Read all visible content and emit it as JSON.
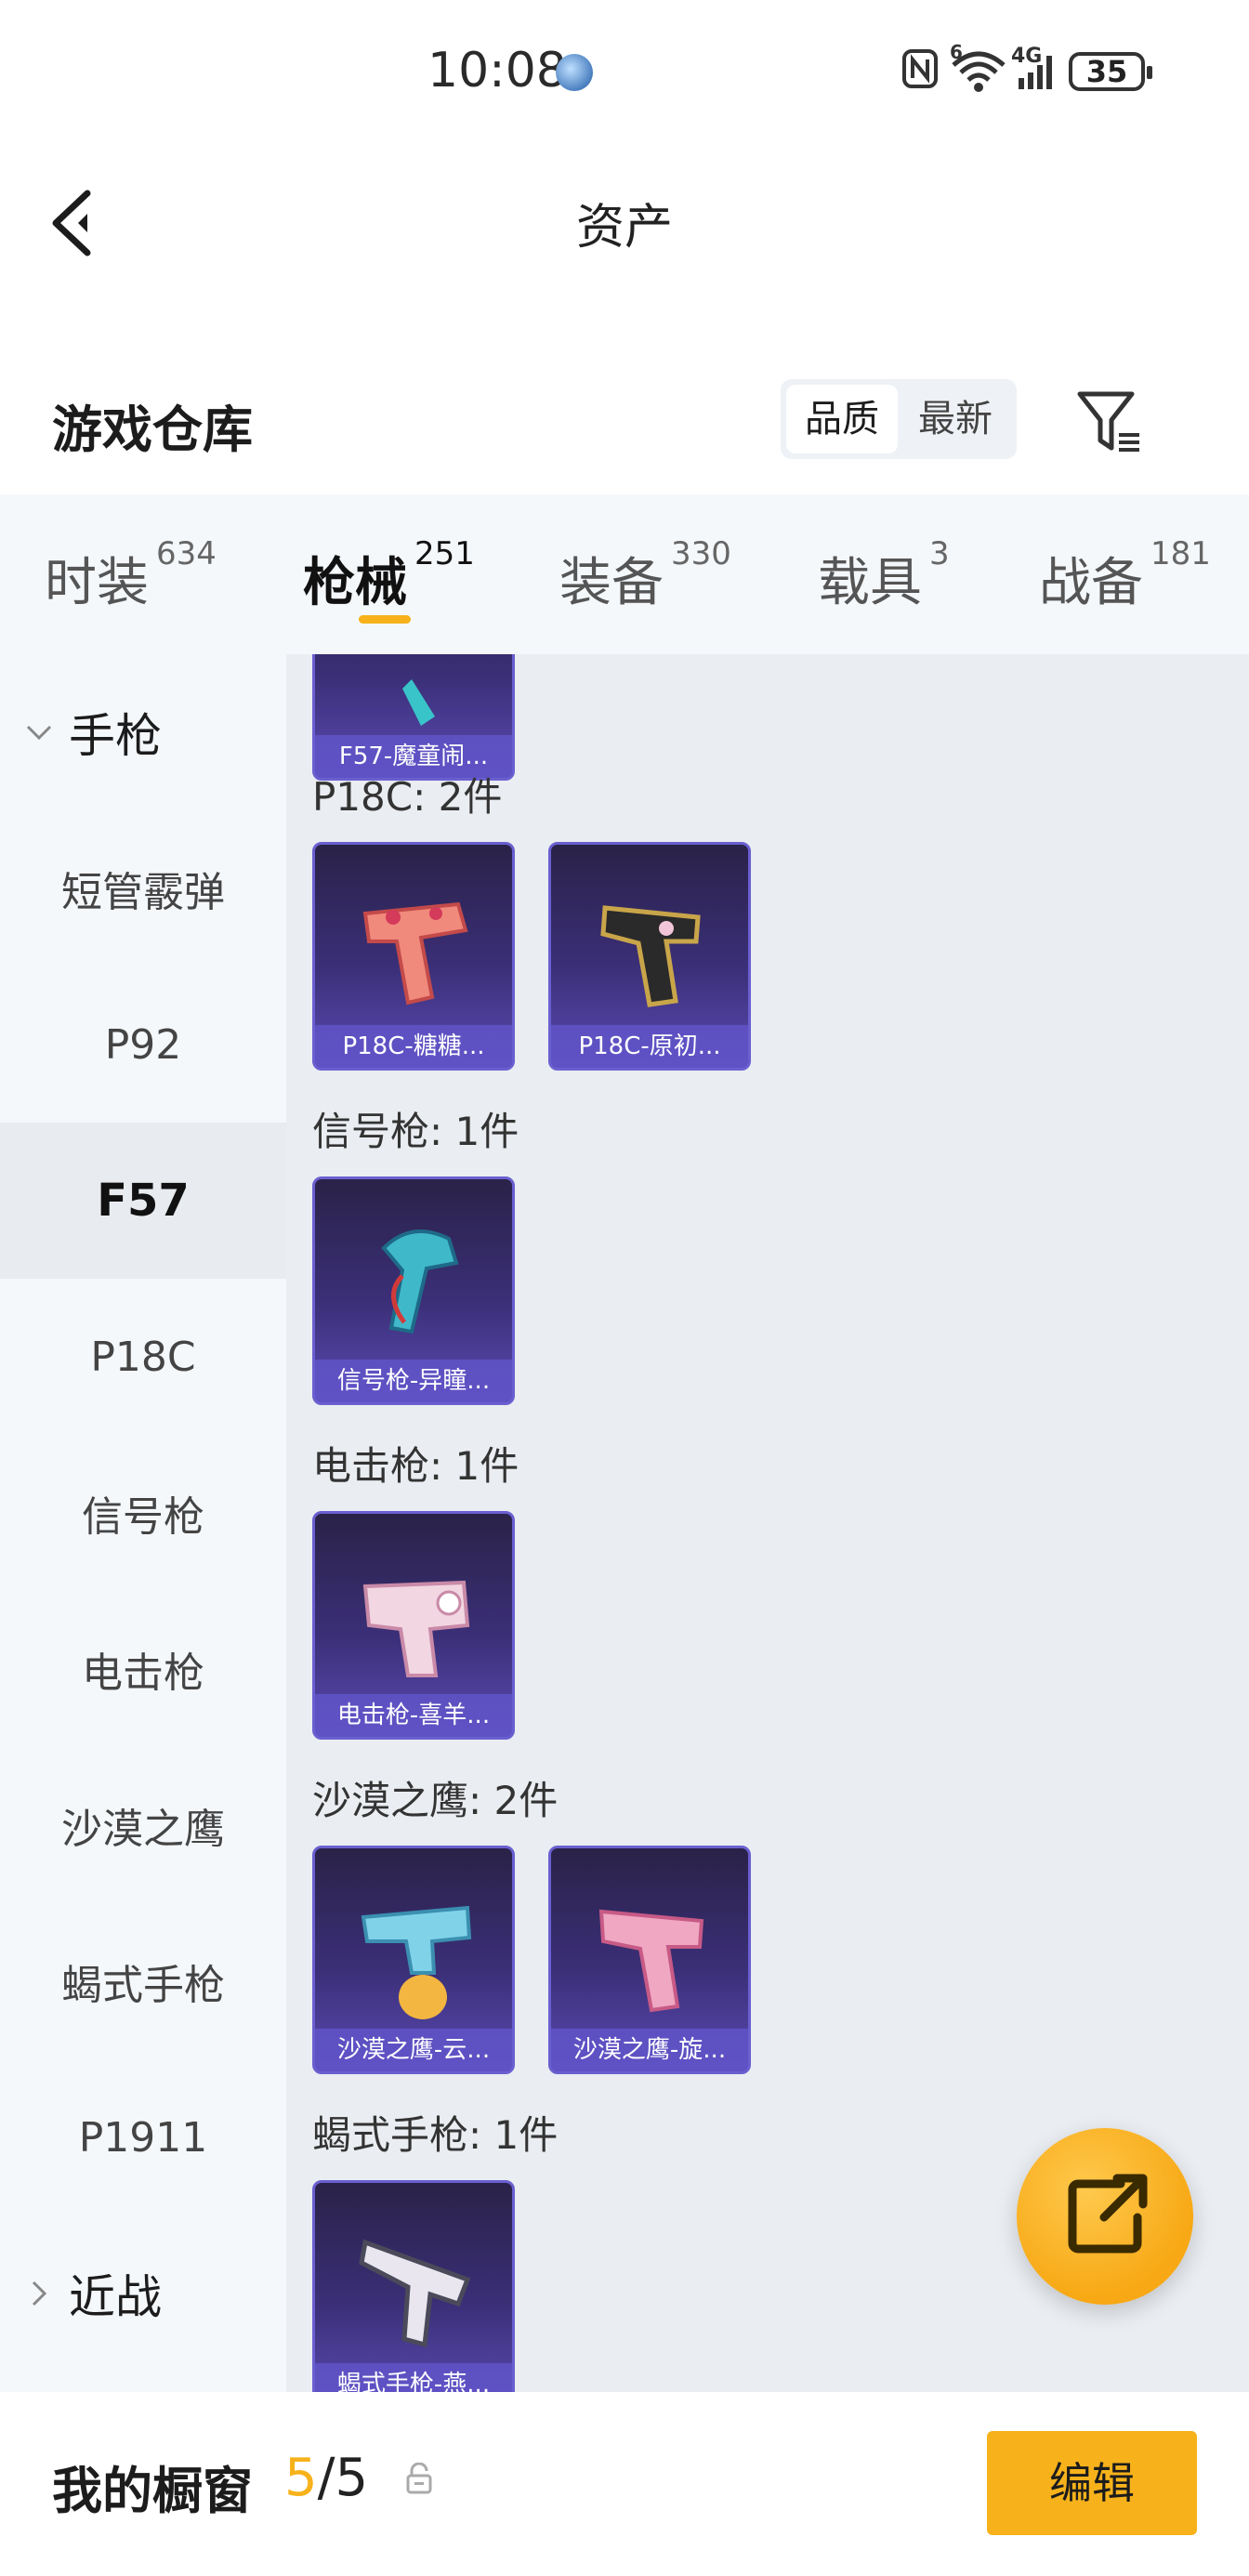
{
  "status": {
    "time": "10:08",
    "battery": "35",
    "network_small": "6",
    "network_gen": "4G"
  },
  "header": {
    "title": "资产"
  },
  "warehouse": {
    "title": "游戏仓库",
    "sort_quality": "品质",
    "sort_newest": "最新"
  },
  "tabs": [
    {
      "label": "时装",
      "count": "634"
    },
    {
      "label": "枪械",
      "count": "251"
    },
    {
      "label": "装备",
      "count": "330"
    },
    {
      "label": "载具",
      "count": "3"
    },
    {
      "label": "战备",
      "count": "181"
    }
  ],
  "sidebar": {
    "group_pistol": "手枪",
    "items": [
      "短管霰弹",
      "P92",
      "F57",
      "P18C",
      "信号枪",
      "电击枪",
      "沙漠之鹰",
      "蝎式手枪",
      "P1911"
    ],
    "group_melee": "近战"
  },
  "sections": [
    {
      "label": "",
      "items": [
        "F57-魔童闹..."
      ]
    },
    {
      "label": "P18C: 2件",
      "items": [
        "P18C-糖糖...",
        "P18C-原初..."
      ]
    },
    {
      "label": "信号枪: 1件",
      "items": [
        "信号枪-异瞳..."
      ]
    },
    {
      "label": "电击枪: 1件",
      "items": [
        "电击枪-喜羊..."
      ]
    },
    {
      "label": "沙漠之鹰: 2件",
      "items": [
        "沙漠之鹰-云...",
        "沙漠之鹰-旋..."
      ]
    },
    {
      "label": "蝎式手枪: 1件",
      "items": [
        "蝎式手枪-燕..."
      ]
    }
  ],
  "bottom": {
    "title": "我的橱窗",
    "current": "5",
    "separator": "/",
    "total": "5",
    "edit_label": "编辑"
  },
  "colors": {
    "accent": "#f7b21b",
    "card_bg": "#3b2f78",
    "card_label": "#6054c8"
  }
}
